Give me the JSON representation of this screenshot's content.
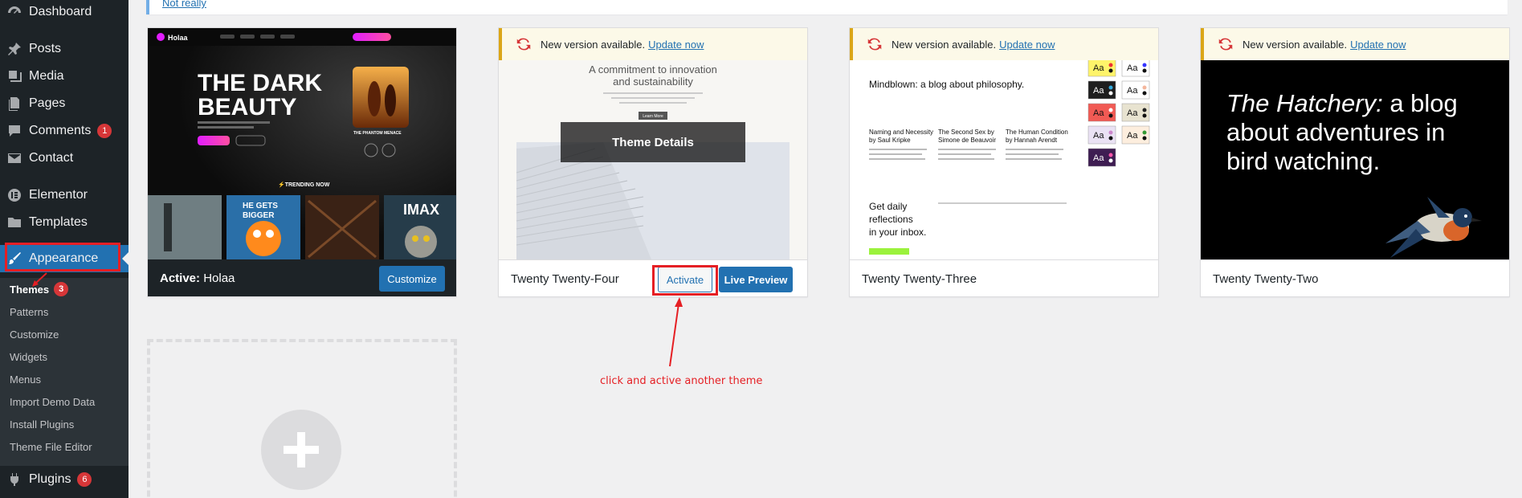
{
  "sidebar": {
    "items": [
      {
        "label": "Dashboard",
        "icon": "dashboard-icon"
      },
      {
        "label": "Posts",
        "icon": "pin-icon"
      },
      {
        "label": "Media",
        "icon": "media-icon"
      },
      {
        "label": "Pages",
        "icon": "pages-icon"
      },
      {
        "label": "Comments",
        "icon": "comments-icon",
        "badge": "1"
      },
      {
        "label": "Contact",
        "icon": "mail-icon"
      },
      {
        "label": "Elementor",
        "icon": "elementor-icon"
      },
      {
        "label": "Templates",
        "icon": "folder-icon"
      },
      {
        "label": "Appearance",
        "icon": "paintbrush-icon"
      },
      {
        "label": "Plugins",
        "icon": "plugin-icon",
        "badge": "6"
      }
    ],
    "submenu": [
      {
        "label": "Themes",
        "badge": "3",
        "current": true
      },
      {
        "label": "Patterns"
      },
      {
        "label": "Customize"
      },
      {
        "label": "Widgets"
      },
      {
        "label": "Menus"
      },
      {
        "label": "Import Demo Data"
      },
      {
        "label": "Install Plugins"
      },
      {
        "label": "Theme File Editor"
      }
    ]
  },
  "top_notice": {
    "link": "Not really"
  },
  "themes": {
    "active": {
      "prefix": "Active:",
      "name": "Holaa",
      "button": "Customize",
      "screenshot": {
        "logo": "Holaa",
        "headline_1": "THE DARK",
        "headline_2": "BEAUTY",
        "movie_title": "THE PHANTOM MENACE",
        "trending": "⚡TRENDING NOW",
        "poster_1": "HE GETS",
        "poster_2": "BIGGER",
        "poster_3": "IMAX"
      }
    },
    "tt4": {
      "name": "Twenty Twenty-Four",
      "update_text": "New version available.",
      "update_link": "Update now",
      "details": "Theme Details",
      "activate": "Activate",
      "live_preview": "Live Preview",
      "screenshot": {
        "line_1": "A commitment to innovation",
        "line_2": "and sustainability",
        "button": "Learn More"
      }
    },
    "tt3": {
      "name": "Twenty Twenty-Three",
      "update_text": "New version available.",
      "update_link": "Update now",
      "screenshot": {
        "title": "Mindblown: a blog about philosophy.",
        "col_1": [
          "Naming and Necessity",
          "by Saul Kripke"
        ],
        "col_2": [
          "The Second Sex by",
          "Simone de Beauvoir"
        ],
        "col_3": [
          "The Human Condition",
          "by Hannah Arendt"
        ],
        "signup": [
          "Get daily",
          "reflections",
          "in your inbox."
        ],
        "swatch_label": "Aa"
      }
    },
    "tt2": {
      "name": "Twenty Twenty-Two",
      "update_text": "New version available.",
      "update_link": "Update now",
      "screenshot": {
        "line_1_italic": "The Hatchery:",
        "line_1_rest": " a blog",
        "line_2": "about adventures in",
        "line_3": "bird watching."
      }
    }
  },
  "annotation": "click and active another theme",
  "colors": {
    "accent": "#2271b1",
    "sidebar": "#1d2327",
    "annotation_red": "#e51f24",
    "notice_yellow": "#dba617"
  }
}
